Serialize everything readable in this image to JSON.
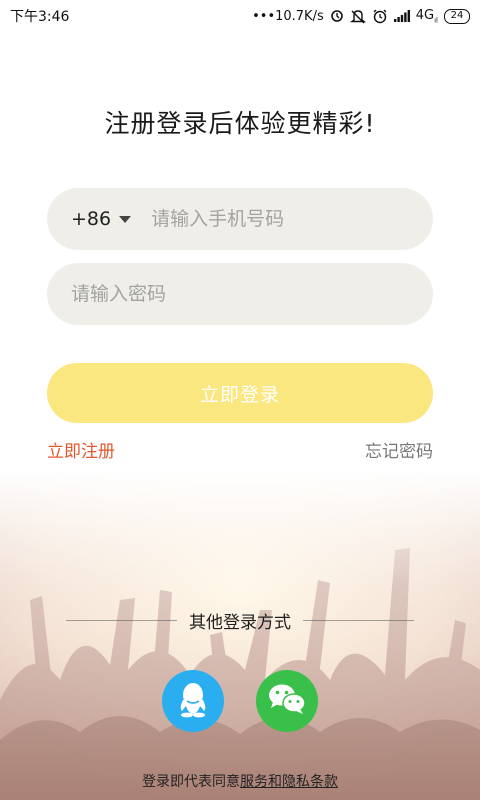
{
  "status_bar": {
    "time": "下午3:46",
    "network_speed": "•••10.7K/s",
    "network_type": "4G",
    "battery": "24",
    "icons": [
      "data-saver-icon",
      "mute-icon",
      "alarm-icon",
      "signal-icon"
    ]
  },
  "title": "注册登录后体验更精彩!",
  "phone_field": {
    "country_code": "+86",
    "placeholder": "请输入手机号码"
  },
  "password_field": {
    "placeholder": "请输入密码"
  },
  "login_button": "立即登录",
  "register_link": "立即注册",
  "forgot_link": "忘记密码",
  "other_login": {
    "label": "其他登录方式",
    "options": [
      "qq-icon",
      "wechat-icon"
    ]
  },
  "terms": {
    "prefix": "登录即代表同意",
    "link": "服务和隐私条款"
  },
  "colors": {
    "login_button": "#fbe77f",
    "register_link": "#e2572c",
    "qq": "#2aaeef",
    "wechat": "#3ac04a",
    "field_bg": "#efeee9"
  }
}
